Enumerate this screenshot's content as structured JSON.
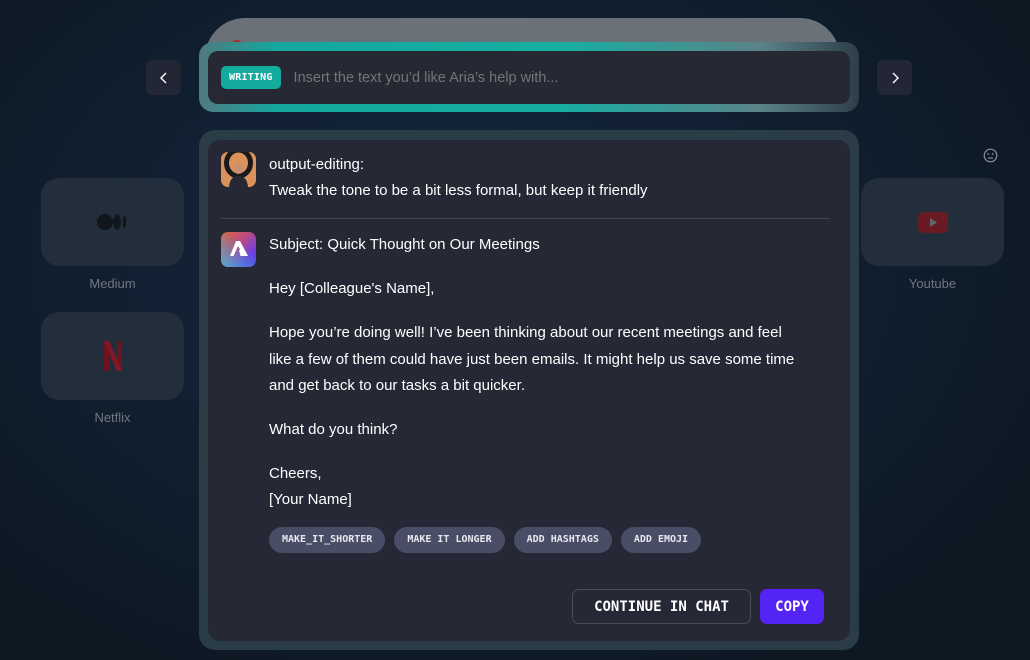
{
  "background_apps": [
    {
      "label": "Medium",
      "icon": "medium-icon"
    },
    {
      "label": "Netflix",
      "icon": "netflix-icon"
    },
    {
      "label": "Youtube",
      "icon": "youtube-icon"
    }
  ],
  "nav": {
    "prev_icon": "chevron-left-icon",
    "next_icon": "chevron-right-icon"
  },
  "input": {
    "badge": "WRITING",
    "placeholder": "Insert the text you’d like Aria’s help with...",
    "value": ""
  },
  "conversation": {
    "user": {
      "label": "output-editing:",
      "message": "Tweak the tone to be a bit less formal, but keep it friendly"
    },
    "assistant": {
      "subject": "Subject: Quick Thought on Our Meetings",
      "greeting": "Hey [Colleague's Name],",
      "body_lines": [
        "Hope you’re doing well! I’ve been thinking about our recent meetings and feel",
        "like a few of them could have just been emails. It might help us save some time",
        "and get back to our tasks a bit quicker."
      ],
      "question": "What do you think?",
      "signoff": "Cheers,",
      "signature": "[Your Name]"
    }
  },
  "chips": [
    "MAKE_IT_SHORTER",
    "MAKE IT LONGER",
    "ADD HASHTAGS",
    "ADD EMOJI"
  ],
  "actions": {
    "continue_label": "CONTINUE IN CHAT",
    "copy_label": "COPY"
  },
  "colors": {
    "accent_teal": "#13ab9e",
    "primary_button": "#5424f5",
    "card_bg": "#262836"
  }
}
